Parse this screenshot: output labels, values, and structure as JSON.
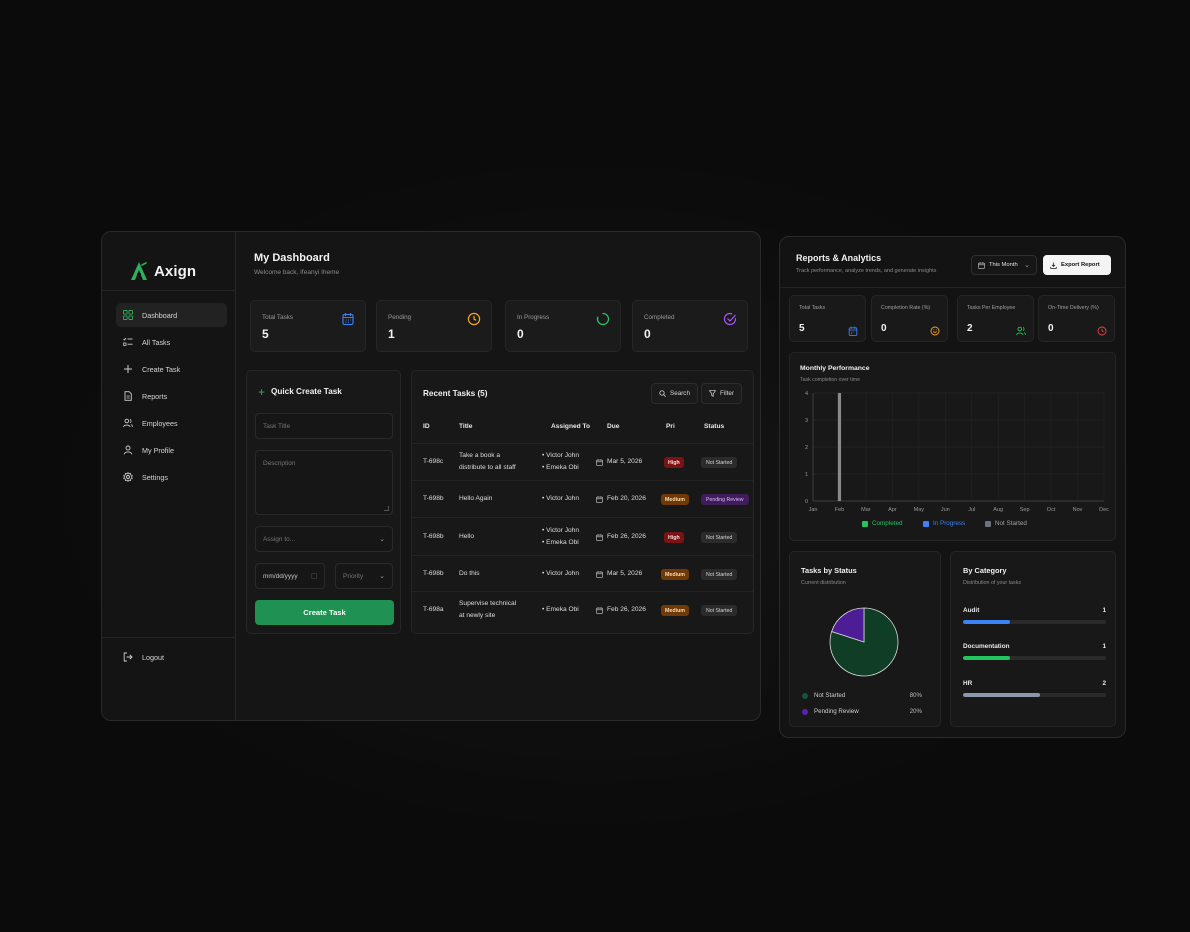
{
  "brand": {
    "name": "Axign"
  },
  "sidebar": {
    "items": [
      {
        "label": "Dashboard",
        "icon": "grid-icon",
        "active": true
      },
      {
        "label": "All Tasks",
        "icon": "list-check-icon"
      },
      {
        "label": "Create Task",
        "icon": "plus-icon"
      },
      {
        "label": "Reports",
        "icon": "file-icon"
      },
      {
        "label": "Employees",
        "icon": "users-icon"
      },
      {
        "label": "My Profile",
        "icon": "user-icon"
      },
      {
        "label": "Settings",
        "icon": "gear-icon"
      }
    ],
    "logout": "Logout"
  },
  "dashboard": {
    "title": "My Dashboard",
    "subtitle": "Welcome back, Ifeanyi Iheme",
    "stats": [
      {
        "label": "Total Tasks",
        "value": "5",
        "icon": "calendar-icon",
        "color": "#3b82f6"
      },
      {
        "label": "Pending",
        "value": "1",
        "icon": "clock-icon",
        "color": "#f5a524"
      },
      {
        "label": "In Progress",
        "value": "0",
        "icon": "spinner-icon",
        "color": "#22c55e"
      },
      {
        "label": "Completed",
        "value": "0",
        "icon": "check-circle-icon",
        "color": "#a855f7"
      }
    ]
  },
  "quick_create": {
    "title": "Quick Create Task",
    "title_placeholder": "Task Title",
    "description_placeholder": "Description",
    "assign_placeholder": "Assign to...",
    "date_placeholder": "mm/dd/yyyy",
    "priority_placeholder": "Priority",
    "button": "Create Task"
  },
  "recent": {
    "title": "Recent Tasks (5)",
    "search": "Search",
    "filter": "Filter",
    "headers": {
      "id": "ID",
      "title": "Title",
      "assigned": "Assigned To",
      "due": "Due",
      "priority": "Pri",
      "status": "Status"
    },
    "rows": [
      {
        "id": "T-698c",
        "title1": "Take a book a",
        "title2": "distribute to all staff",
        "assign1": "• Victor John",
        "assign2": "• Emeka Obi",
        "due": "Mar 5, 2026",
        "priority": "High",
        "status": "Not Started"
      },
      {
        "id": "T-698b",
        "title1": "Hello Again",
        "title2": "",
        "assign1": "• Victor John",
        "assign2": "",
        "due": "Feb 20, 2026",
        "priority": "Medium",
        "status": "Pending Review"
      },
      {
        "id": "T-698b",
        "title1": "Hello",
        "title2": "",
        "assign1": "• Victor John",
        "assign2": "• Emeka Obi",
        "due": "Feb 26, 2026",
        "priority": "High",
        "status": "Not Started"
      },
      {
        "id": "T-698b",
        "title1": "Do this",
        "title2": "",
        "assign1": "• Victor John",
        "assign2": "",
        "due": "Mar 5, 2026",
        "priority": "Medium",
        "status": "Not Started"
      },
      {
        "id": "T-698a",
        "title1": "Supervise technical",
        "title2": "at newly site",
        "assign1": "• Emeka Obi",
        "assign2": "",
        "due": "Feb 26, 2026",
        "priority": "Medium",
        "status": "Not Started"
      }
    ]
  },
  "reports": {
    "title": "Reports & Analytics",
    "subtitle": "Track performance, analyze trends, and generate insights",
    "period": "This Month",
    "export": "Export Report",
    "stats": [
      {
        "label": "Total Tasks",
        "value": "5",
        "icon": "calendar-icon",
        "color": "#3b82f6"
      },
      {
        "label": "Completion Rate (%)",
        "value": "0",
        "icon": "smile-icon",
        "color": "#f5a524"
      },
      {
        "label": "Tasks Per Employee",
        "value": "2",
        "icon": "users-icon",
        "color": "#22c55e"
      },
      {
        "label": "On-Time Delivery (%)",
        "value": "0",
        "icon": "clock-icon",
        "color": "#ef4444"
      }
    ],
    "performance": {
      "title": "Monthly Performance",
      "subtitle": "Task completion over time"
    },
    "status": {
      "title": "Tasks by Status",
      "subtitle": "Current distribution",
      "items": [
        {
          "label": "Not Started",
          "pct": "80%",
          "color": "#0f3d25"
        },
        {
          "label": "Pending Review",
          "pct": "20%",
          "color": "#4c1d95"
        }
      ]
    },
    "category": {
      "title": "By Category",
      "subtitle": "Distribution of your tasks",
      "items": [
        {
          "name": "Audit",
          "value": "1",
          "fraction": 0.33,
          "color": "#3b82f6"
        },
        {
          "name": "Documentation",
          "value": "1",
          "fraction": 0.33,
          "color": "#22c55e"
        },
        {
          "name": "HR",
          "value": "2",
          "fraction": 0.54,
          "color": "#8b97ad"
        }
      ]
    }
  },
  "chart_data": {
    "type": "bar",
    "categories": [
      "Jan",
      "Feb",
      "Mar",
      "Apr",
      "May",
      "Jun",
      "Jul",
      "Aug",
      "Sep",
      "Oct",
      "Nov",
      "Dec"
    ],
    "series": [
      {
        "name": "Completed",
        "values": [
          0,
          0,
          0,
          0,
          0,
          0,
          0,
          0,
          0,
          0,
          0,
          0
        ],
        "color": "#22c55e"
      },
      {
        "name": "In Progress",
        "values": [
          0,
          0,
          0,
          0,
          0,
          0,
          0,
          0,
          0,
          0,
          0,
          0
        ],
        "color": "#3b82f6"
      },
      {
        "name": "Not Started",
        "values": [
          0,
          4,
          0,
          0,
          0,
          0,
          0,
          0,
          0,
          0,
          0,
          0
        ],
        "color": "#6b7280"
      }
    ],
    "yticks": [
      "0",
      "1",
      "2",
      "3",
      "4"
    ],
    "ylim": [
      0,
      4
    ],
    "grid": true,
    "legend": "bottom",
    "title": "Monthly Performance",
    "subtitle": "Task completion over time"
  }
}
